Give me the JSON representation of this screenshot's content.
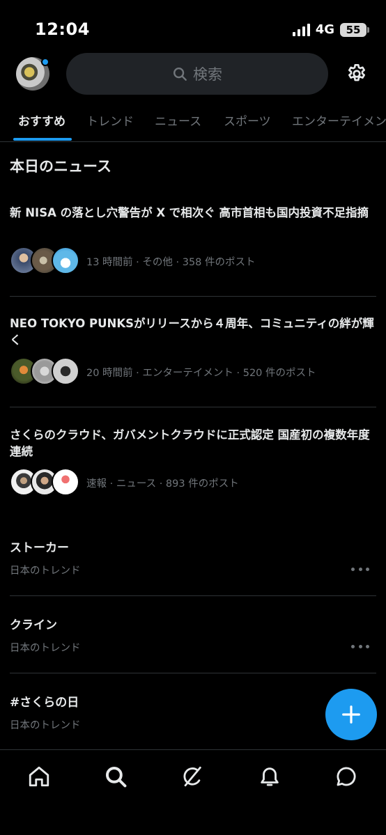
{
  "status_bar": {
    "time": "12:04",
    "network": "4G",
    "battery": "55"
  },
  "top_bar": {
    "search_placeholder": "検索"
  },
  "tabs": [
    {
      "label": "おすすめ",
      "active": true
    },
    {
      "label": "トレンド"
    },
    {
      "label": "ニュース"
    },
    {
      "label": "スポーツ"
    },
    {
      "label": "エンターテイメント"
    }
  ],
  "section_title": "本日のニュース",
  "news": [
    {
      "headline": "新 NISA の落とし穴警告が X で相次ぐ 高市首相も国内投資不足指摘",
      "meta": "13 時間前 · その他 · 358 件のポスト"
    },
    {
      "headline": "NEO TOKYO PUNKSがリリースから４周年、コミュニティの絆が輝く",
      "meta": "20 時間前 · エンターテイメント · 520 件のポスト"
    },
    {
      "headline": "さくらのクラウド、ガバメントクラウドに正式認定 国産初の複数年度連続",
      "meta": "速報 · ニュース · 893 件のポスト"
    }
  ],
  "trends": [
    {
      "title": "ストーカー",
      "subtitle": "日本のトレンド"
    },
    {
      "title": "クライン",
      "subtitle": "日本のトレンド"
    },
    {
      "title": "#さくらの日",
      "subtitle": "日本のトレンド"
    }
  ],
  "colors": {
    "accent": "#1d9bf0",
    "background": "#000000",
    "muted": "#71767b"
  },
  "icons": {
    "settings": "gear-icon",
    "search": "search-icon",
    "compose": "plus-icon",
    "nav": [
      "home-icon",
      "search-icon",
      "grok-icon",
      "bell-icon",
      "message-icon"
    ]
  }
}
